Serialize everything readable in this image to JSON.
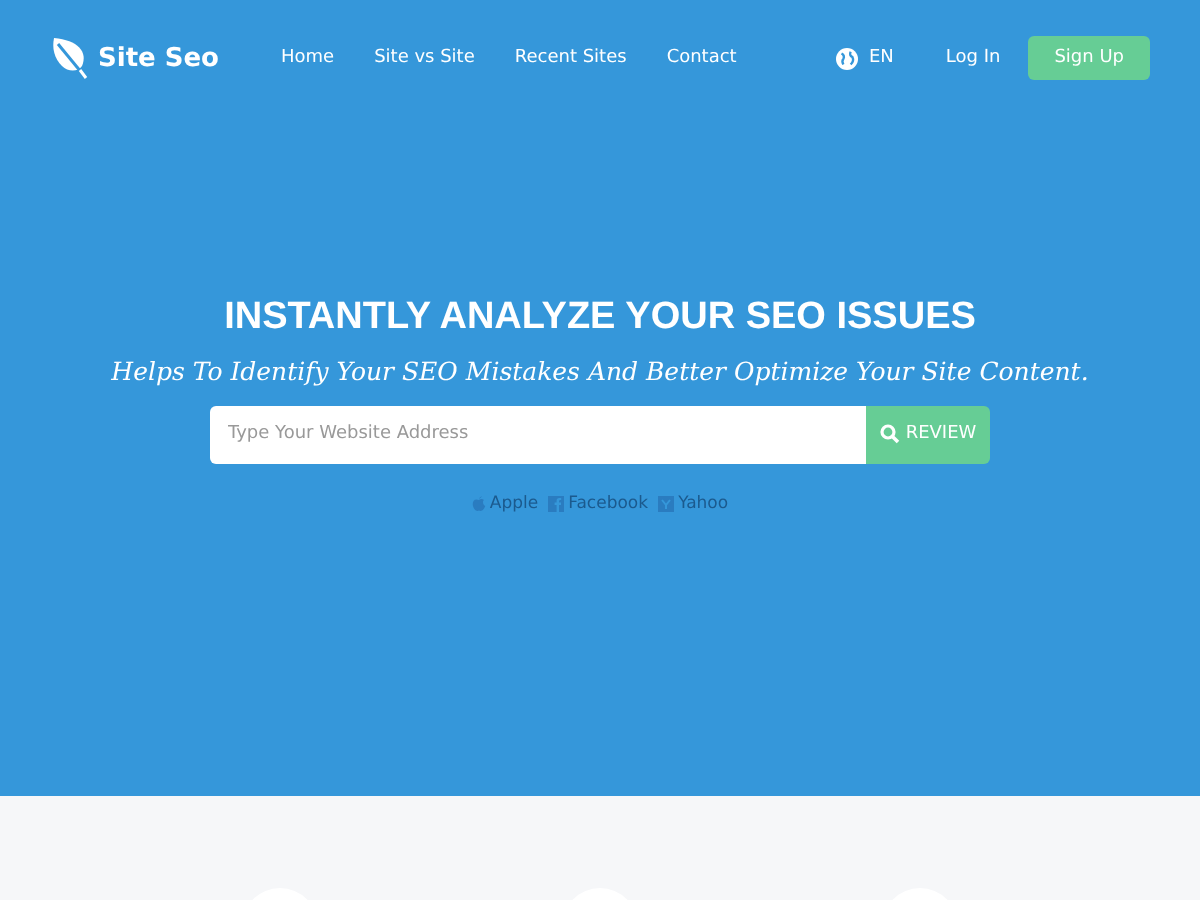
{
  "brand": {
    "name": "Site Seo"
  },
  "nav": [
    {
      "label": "Home"
    },
    {
      "label": "Site vs Site"
    },
    {
      "label": "Recent Sites"
    },
    {
      "label": "Contact"
    }
  ],
  "language": "EN",
  "login": "Log In",
  "signup": "Sign Up",
  "hero": {
    "title": "INSTANTLY ANALYZE YOUR SEO ISSUES",
    "subtitle": "Helps To Identify Your SEO Mistakes And Better Optimize Your Site Content.",
    "placeholder": "Type Your Website Address",
    "button": "REVIEW",
    "examples": [
      {
        "kind": "apple",
        "label": "Apple"
      },
      {
        "kind": "facebook",
        "label": "Facebook"
      },
      {
        "kind": "yahoo",
        "label": "Yahoo"
      }
    ]
  }
}
